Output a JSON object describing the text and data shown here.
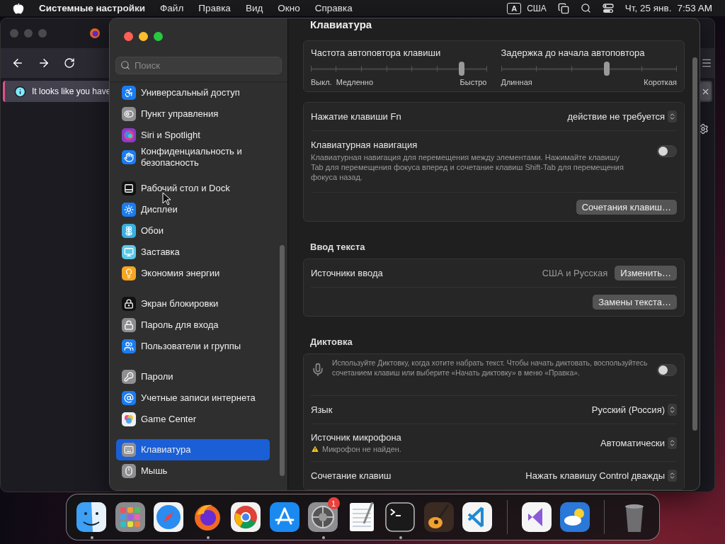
{
  "menubar": {
    "app": "Системные настройки",
    "menus": [
      "Файл",
      "Правка",
      "Вид",
      "Окно",
      "Справка"
    ],
    "input_source": {
      "letter": "A",
      "label": "США"
    },
    "date": "Чт, 25 янв.",
    "time": "7:53 AM"
  },
  "browser": {
    "notice": "It looks like you have"
  },
  "settings": {
    "search": {
      "placeholder": "Поиск"
    },
    "sidebar": {
      "groups": [
        [
          {
            "label": "Универсальный доступ",
            "color": "#1b7cf0",
            "selected": false
          },
          {
            "label": "Пункт управления",
            "color": "#8e8e93",
            "selected": false
          },
          {
            "label": "Siri и Spotlight",
            "color": "#8a3cc8",
            "selected": false
          },
          {
            "label": "Конфиденциальность и безопасность",
            "color": "#1b7cf0",
            "selected": false
          }
        ],
        [
          {
            "label": "Рабочий стол и Dock",
            "color": "#111111",
            "selected": false
          },
          {
            "label": "Дисплеи",
            "color": "#1b7cf0",
            "selected": false
          },
          {
            "label": "Обои",
            "color": "#3ab0e0",
            "selected": false
          },
          {
            "label": "Заставка",
            "color": "#5ac8e8",
            "selected": false
          },
          {
            "label": "Экономия энергии",
            "color": "#f5a623",
            "selected": false
          }
        ],
        [
          {
            "label": "Экран блокировки",
            "color": "#111111",
            "selected": false
          },
          {
            "label": "Пароль для входа",
            "color": "#8e8e93",
            "selected": false
          },
          {
            "label": "Пользователи и группы",
            "color": "#1b7cf0",
            "selected": false
          }
        ],
        [
          {
            "label": "Пароли",
            "color": "#8e8e93",
            "selected": false
          },
          {
            "label": "Учетные записи интернета",
            "color": "#1b7cf0",
            "selected": false
          },
          {
            "label": "Game Center",
            "color": "#f0f0f0",
            "selected": false
          }
        ],
        [
          {
            "label": "Клавиатура",
            "color": "#8e8e93",
            "selected": true
          },
          {
            "label": "Мышь",
            "color": "#8e8e93",
            "selected": false
          }
        ]
      ]
    },
    "title": "Клавиатура",
    "sections": [
      {
        "rows": [
          {
            "kind": "sliders",
            "sliders": [
              {
                "title": "Частота автоповтора клавиши",
                "level": 0.857,
                "min_labels": [
                  "Выкл.",
                  "Медленно"
                ],
                "max_label": "Быстро"
              },
              {
                "title": "Задержка до начала автоповтора",
                "level": 0.6,
                "min_labels": [
                  "Длинная"
                ],
                "max_label": "Короткая"
              }
            ]
          }
        ]
      },
      {
        "rows": [
          {
            "kind": "popup",
            "label": "Нажатие клавиши Fn",
            "value": "действие не требуется"
          },
          {
            "kind": "toggle",
            "label": "Клавиатурная навигация",
            "description": "Клавиатурная навигация для перемещения между элементами. Нажимайте клавишу Tab для перемещения фокуса вперед и сочетание клавиш Shift-Tab для перемещения фокуса назад.",
            "on": false
          },
          {
            "kind": "button",
            "button": "Сочетания клавиш…"
          }
        ]
      },
      {
        "title": "Ввод текста",
        "rows": [
          {
            "kind": "value-button",
            "label": "Источники ввода",
            "value": "США и Русская",
            "button": "Изменить…"
          },
          {
            "kind": "button",
            "button": "Замены текста…"
          }
        ]
      },
      {
        "title": "Диктовка",
        "rows": [
          {
            "kind": "mic-toggle",
            "description": "Используйте Диктовку, когда хотите набрать текст. Чтобы начать диктовать, воспользуйтесь сочетанием клавиш или выберите «Начать диктовку» в меню «Правка».",
            "on": false
          },
          {
            "kind": "popup",
            "label": "Язык",
            "value": "Русский (Россия)"
          },
          {
            "kind": "popup",
            "label": "Источник микрофона",
            "value": "Автоматически",
            "note": "Микрофон не найден."
          },
          {
            "kind": "popup",
            "label": "Сочетание клавиш",
            "value": "Нажать клавишу Control дважды"
          }
        ]
      }
    ]
  },
  "dock": {
    "groups": [
      [
        {
          "running": true
        },
        {
          "running": false
        },
        {
          "running": false
        },
        {
          "running": true
        },
        {
          "running": false
        },
        {
          "running": false
        },
        {
          "running": true,
          "badge": "1"
        },
        {
          "running": false
        },
        {
          "running": true
        },
        {
          "running": false
        },
        {
          "running": false
        }
      ],
      [
        {
          "running": false
        },
        {
          "running": false
        }
      ],
      [
        {
          "running": false
        }
      ]
    ]
  }
}
